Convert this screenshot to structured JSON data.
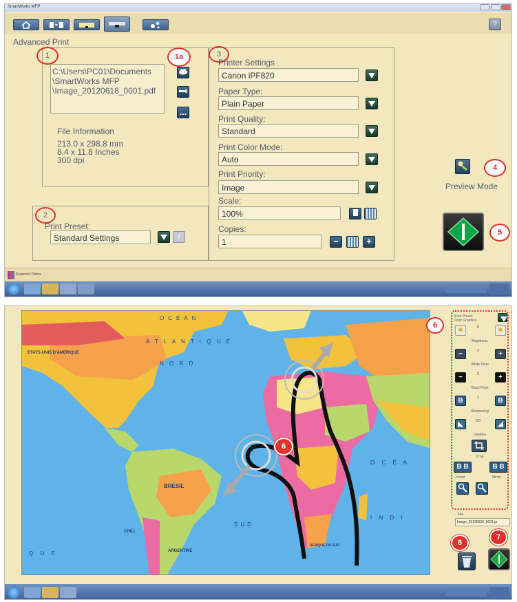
{
  "top_window": {
    "title": "SmartWorks MFP",
    "section_title": "Advanced Print",
    "callouts": {
      "c1": "1",
      "c1a": "1a",
      "c2": "2",
      "c3": "3",
      "c4": "4",
      "c5": "5"
    },
    "file_path": [
      "C:\\Users\\PC01\\Documents",
      "\\SmartWorks MFP",
      "\\Image_20120618_0001.pdf"
    ],
    "file_info": {
      "heading": "File Information",
      "lines": [
        "213.0 x 298.8 mm",
        "8.4 x 11.8 Inches",
        "300 dpi"
      ]
    },
    "browse_button": "...",
    "print_preset": {
      "label": "Print Preset:",
      "value": "Standard Settings",
      "info": "i"
    },
    "printer_settings": {
      "label": "Printer Settings",
      "printer": "Canon iPF820",
      "paper_type_label": "Paper Type:",
      "paper_type": "Plain Paper",
      "print_quality_label": "Print Quality:",
      "print_quality": "Standard",
      "color_mode_label": "Print Color Mode:",
      "color_mode": "Auto",
      "priority_label": "Print Priority:",
      "priority": "Image",
      "scale_label": "Scale:",
      "scale": "100%",
      "copies_label": "Copies:",
      "copies": "1",
      "minus": "−",
      "plus": "+"
    },
    "preview_mode_label": "Preview Mode",
    "help": "?",
    "app_strip_label": "Scanners Online"
  },
  "bottom_window": {
    "map_labels": {
      "ocean": "OCEAN",
      "atlantique": "A T L A N T I Q U E",
      "nord": "N O R D",
      "usa": "ETATS-UNIS D'AMERIQUE",
      "bresil": "BRESIL",
      "chili": "CHILI",
      "argentine": "ARGENTINE",
      "sud": "SUD",
      "que": "Q U E",
      "oc": "O C E A",
      "indi": "I N D I",
      "afrique": "AFRIQUE DU SUD"
    },
    "gesture_callout": "6",
    "scan_preset": {
      "label": "Scan Preset",
      "value": "Color Graphics"
    },
    "adjustments": [
      {
        "name": "Brightness",
        "value": "0"
      },
      {
        "name": "White Point",
        "value": "2"
      },
      {
        "name": "Black Point",
        "value": "2"
      },
      {
        "name": "Sharpening",
        "value": "1"
      },
      {
        "name": "Deskew",
        "value": "0.0"
      }
    ],
    "crop_label": "Crop",
    "invert_label": "Invert",
    "mirror_label": "Mirror",
    "file_label": "File",
    "file_name": "Image_20120620_0001.jp",
    "callouts": {
      "c6": "6",
      "c7": "7",
      "c8": "8"
    }
  },
  "colors": {
    "panel_bg": "#f3e7bd",
    "callout_red": "#e2302b",
    "go_green": "#0d8a3a"
  }
}
